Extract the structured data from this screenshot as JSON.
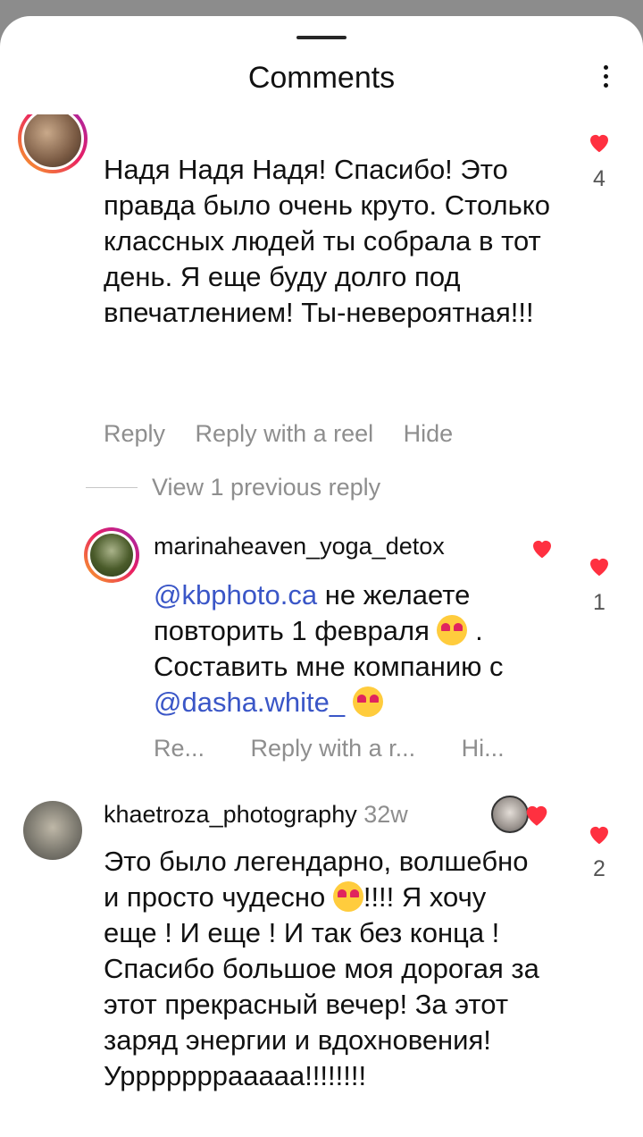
{
  "header": {
    "title": "Comments"
  },
  "comments": [
    {
      "text": "Надя Надя Надя! Спасибо! Это правда было очень круто. Столько классных людей ты собрала в тот день. Я еще буду долго под впечатлением! Ты-невероятная!!!",
      "likes": "4",
      "actions": {
        "reply": "Reply",
        "reply_reel": "Reply with a reel",
        "hide": "Hide"
      }
    },
    {
      "view_previous": "View 1 previous reply"
    },
    {
      "username": "marinaheaven_yoga_detox",
      "mention1": "@kbphoto.ca",
      "text1": " не желаете повторить 1 февраля ",
      "text2": " . Составить мне компанию с ",
      "mention2": "@dasha.white_",
      "likes": "1",
      "actions": {
        "reply": "Re...",
        "reply_reel": "Reply with a r...",
        "hide": "Hi..."
      }
    },
    {
      "username": "khaetroza_photography",
      "time": "32w",
      "text_a": "Это было легендарно, волшебно и просто чудесно ",
      "text_b": "!!!! Я хочу еще ! И еще ! И так без конца ! Спасибо большое моя дорогая за этот прекрасный вечер! За этот заряд энергии и вдохновения! Урррррррааааа!!!!!!!!",
      "likes": "2"
    }
  ],
  "icons": {
    "heart": "heart-icon",
    "more": "more-vertical-icon",
    "creator_heart": "creator-liked-heart-icon"
  },
  "colors": {
    "heart": "#ff3040",
    "mention": "#3a56c7",
    "muted": "#8e8e8e"
  }
}
